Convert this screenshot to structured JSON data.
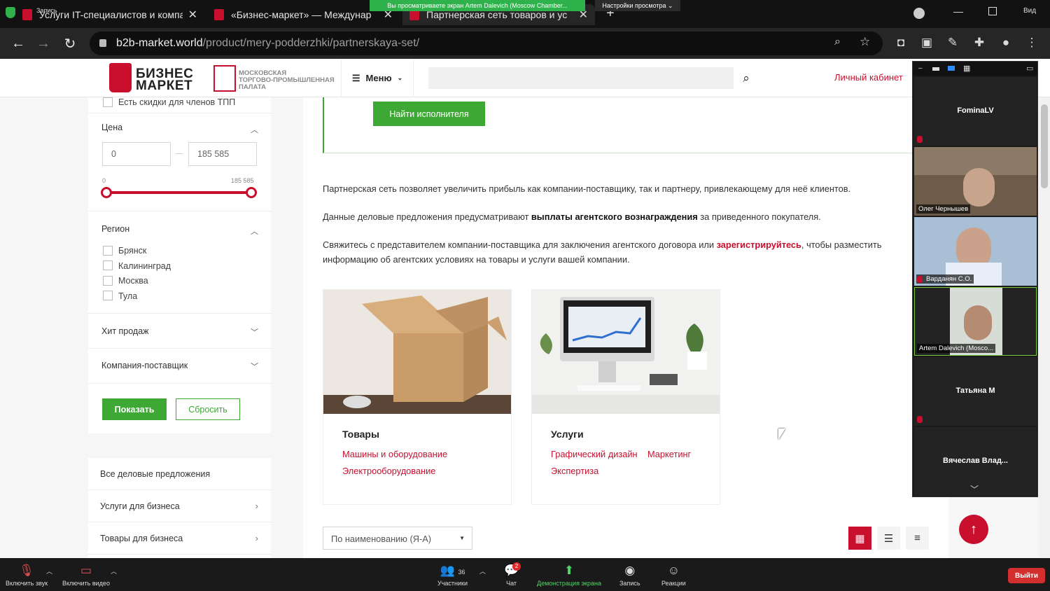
{
  "browser": {
    "tabs": [
      {
        "title": "Услуги IT-специалистов и компа"
      },
      {
        "title": "«Бизнес-маркет» — Междунар"
      },
      {
        "title": "Партнерская сеть товаров и ус"
      }
    ],
    "recording_label": "Запись",
    "url_domain": "b2b-market.world",
    "url_path": "/product/mery-podderzhki/partnerskaya-set/",
    "view_label": "Вид"
  },
  "zoom": {
    "share_banner": "Вы просматриваете экран Artem Dalevich (Moscow Chamber...",
    "view_settings": "Настройки просмотра",
    "participants": [
      {
        "name": "FominaLV",
        "video": false
      },
      {
        "name": "Олег Чернышев",
        "video": true
      },
      {
        "name": "Варданян С.О.",
        "video": true
      },
      {
        "name": "Artem Dalevich (Mosco...",
        "video": true
      },
      {
        "name": "Татьяна М",
        "video": false
      },
      {
        "name": "Вячеслав  Влад...",
        "video": false
      }
    ],
    "toolbar": {
      "unmute": "Включить звук",
      "start_video": "Включить видео",
      "participants": "Участники",
      "participants_count": "36",
      "chat": "Чат",
      "chat_badge": "2",
      "share": "Демонстрация экрана",
      "record": "Запись",
      "reactions": "Реакции",
      "leave": "Выйти"
    }
  },
  "site": {
    "logo": {
      "line1": "БИЗНЕС",
      "line2": "МАРКЕТ"
    },
    "tpp": {
      "line1": "МОСКОВСКАЯ",
      "line2": "ТОРГОВО-ПРОМЫШЛЕННАЯ",
      "line3": "ПАЛАТА"
    },
    "menu_label": "Меню",
    "cabinet": "Личный кабинет"
  },
  "filters": {
    "discount_checkbox": "Есть скидки для членов ТПП",
    "price": {
      "title": "Цена",
      "min_value": "0",
      "max_value": "185 585",
      "range_min": "0",
      "range_max": "185 585"
    },
    "region": {
      "title": "Регион",
      "options": [
        "Брянск",
        "Калининград",
        "Москва",
        "Тула"
      ]
    },
    "bestseller": "Хит продаж",
    "supplier": "Компания-поставщик",
    "show": "Показать",
    "reset": "Сбросить"
  },
  "sidenav": [
    "Все деловые предложения",
    "Услуги для бизнеса",
    "Товары для бизнеса"
  ],
  "main": {
    "find_button": "Найти исполнителя",
    "para1": "Партнерская сеть позволяет увеличить прибыль как компании-поставщику, так и партнеру, привлекающему для неё клиентов.",
    "para2_a": "Данные деловые предложения предусматривают ",
    "para2_b": "выплаты агентского вознаграждения",
    "para2_c": " за приведенного покупателя.",
    "para3_a": "Свяжитесь с представителем компании-поставщика для заключения агентского договора или ",
    "para3_link": "зарегистрируйтесь",
    "para3_c": ", чтобы разместить информацию об агентских условиях на товары и услуги вашей компании.",
    "cards": [
      {
        "title": "Товары",
        "links": [
          "Машины и оборудование",
          "Электрооборудование"
        ]
      },
      {
        "title": "Услуги",
        "links": [
          "Графический дизайн",
          "Маркетинг",
          "Экспертиза"
        ]
      }
    ],
    "sort_value": "По наименованию (Я-А)"
  },
  "colors": {
    "brand_red": "#c8102e",
    "action_green": "#3da833"
  }
}
